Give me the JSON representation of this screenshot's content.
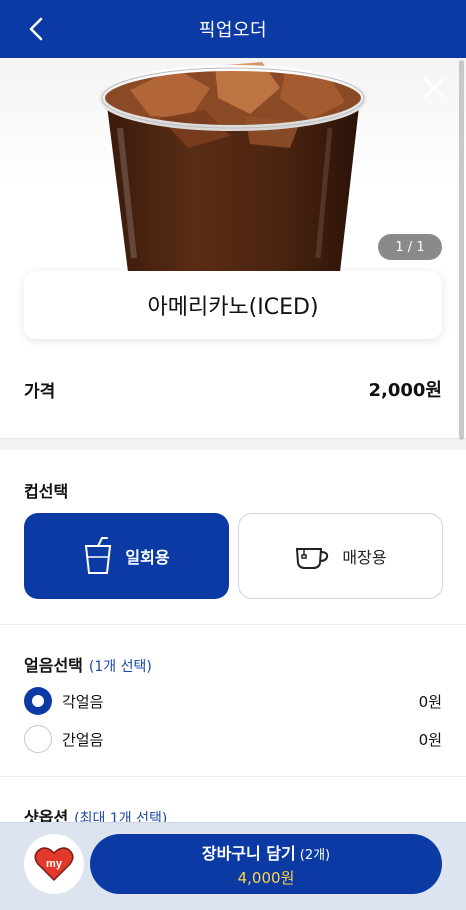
{
  "header": {
    "title": "픽업오더",
    "back_icon": "chevron-left-icon"
  },
  "hero": {
    "counter": "1 / 1",
    "close_icon": "close-icon"
  },
  "product": {
    "name": "아메리카노(ICED)"
  },
  "price": {
    "label": "가격",
    "value": "2,000원"
  },
  "cup": {
    "title": "컵선택",
    "options": [
      {
        "label": "일회용",
        "icon": "disposable-cup-icon",
        "selected": true
      },
      {
        "label": "매장용",
        "icon": "mug-icon",
        "selected": false
      }
    ]
  },
  "ice": {
    "title": "얼음선택",
    "hint": "(1개 선택)",
    "options": [
      {
        "label": "각얼음",
        "price": "0원",
        "selected": true
      },
      {
        "label": "간얼음",
        "price": "0원",
        "selected": false
      }
    ]
  },
  "shot": {
    "title": "샷옵션",
    "hint": "(최대 1개 선택)"
  },
  "bottom": {
    "my_label": "my",
    "cart_label": "장바구니 담기",
    "cart_count": "(2개)",
    "cart_total": "4,000원"
  },
  "colors": {
    "primary": "#0b3aa4",
    "accent_yellow": "#ffd24a",
    "my_heart": "#e3392d"
  }
}
